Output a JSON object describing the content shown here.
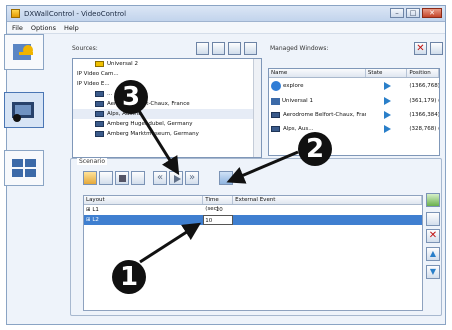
{
  "window": {
    "title": "DXWallControl - VideoControl"
  },
  "menu": [
    "File",
    "Options",
    "Help"
  ],
  "sources": {
    "label": "Sources:",
    "tree": [
      {
        "label": "Universal 2"
      },
      {
        "label": "IP Video Cam..."
      },
      {
        "label": "IP Video E..."
      },
      {
        "label": "..."
      },
      {
        "label": "Aerod... Belfort-Chaux, France"
      },
      {
        "label": "Alps, Austria"
      },
      {
        "label": "Amberg Hugendubel, Germany"
      },
      {
        "label": "Amberg Marktmuseum, Germany"
      }
    ]
  },
  "managed": {
    "label": "Managed Windows:",
    "columns": [
      "Name",
      "State",
      "Position"
    ],
    "rows": [
      {
        "name": "explore",
        "position": "(1366,768) ("
      },
      {
        "name": "Universal 1",
        "position": "(361,179) (6"
      },
      {
        "name": "Aerodrome Belfort-Chaux, France",
        "position": "(1366,384) ("
      },
      {
        "name": "Alps, Aus...",
        "position": "(328,768) (1"
      }
    ]
  },
  "scenario": {
    "label": "Scenario",
    "columns": [
      "Layout",
      "Time (sec)",
      "External Event"
    ],
    "rows": [
      {
        "layout": "L1",
        "time": "10",
        "event": ""
      },
      {
        "layout": "L2",
        "time": "10",
        "event": ""
      }
    ]
  },
  "callouts": [
    "1",
    "2",
    "3"
  ],
  "colors": {
    "accent": "#3f7fd0",
    "play": "#2a7fc9"
  }
}
